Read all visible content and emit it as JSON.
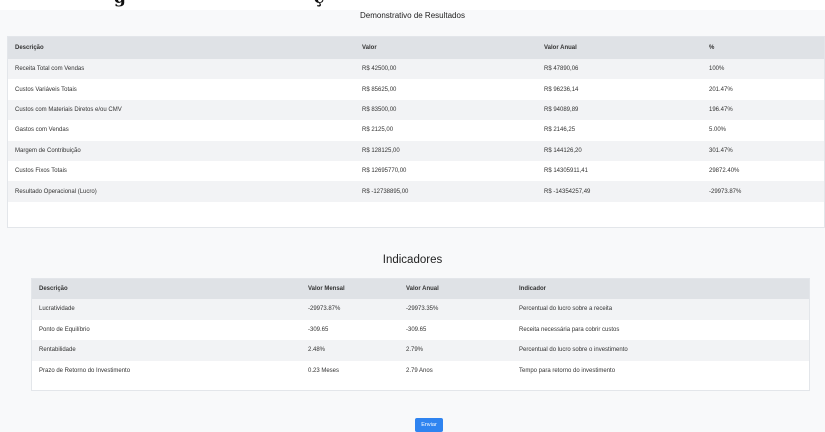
{
  "header": {
    "clipped_heading_left": "g",
    "clipped_heading_right": "ç",
    "subtitle": "Demonstrativo de Resultados"
  },
  "results_table": {
    "columns": [
      "Descrição",
      "Valor",
      "Valor Anual",
      "%"
    ],
    "rows": [
      [
        "Receita Total com Vendas",
        "R$ 42500,00",
        "R$ 47890,06",
        "100%"
      ],
      [
        "Custos Variáveis Totais",
        "R$ 85625,00",
        "R$ 96236,14",
        "201.47%"
      ],
      [
        "Custos com Materiais Diretos e/ou CMV",
        "R$ 83500,00",
        "R$ 94089,89",
        "196.47%"
      ],
      [
        "Gastos com Vendas",
        "R$ 2125,00",
        "R$ 2146,25",
        "5.00%"
      ],
      [
        "Margem de Contribuição",
        "R$ 128125,00",
        "R$ 144126,20",
        "301.47%"
      ],
      [
        "Custos Fixos Totais",
        "R$ 12695770,00",
        "R$ 14305911,41",
        "29872.40%"
      ],
      [
        "Resultado Operacional (Lucro)",
        "R$ -12738895,00",
        "R$ -14354257,49",
        "-29973.87%"
      ]
    ]
  },
  "indicators": {
    "title": "Indicadores",
    "columns": [
      "Descrição",
      "Valor Mensal",
      "Valor Anual",
      "Indicador"
    ],
    "rows": [
      [
        "Lucratividade",
        "-29973.87%",
        "-29973.35%",
        "Percentual do lucro sobre a receita"
      ],
      [
        "Ponto de Equilíbrio",
        "-309.65",
        "-309.65",
        "Receita necessária para cobrir custos"
      ],
      [
        "Rentabilidade",
        "2.48%",
        "2.79%",
        "Percentual do lucro sobre o investimento"
      ],
      [
        "Prazo de Retorno do Investimento",
        "0.23 Meses",
        "2.79 Anos",
        "Tempo para retorno do investimento"
      ]
    ]
  },
  "form": {
    "submit_label": "Enviar"
  },
  "colors": {
    "header_bg": "#dfe2e6",
    "stripe_bg": "#f2f3f5",
    "primary_button": "#2f84f0"
  }
}
